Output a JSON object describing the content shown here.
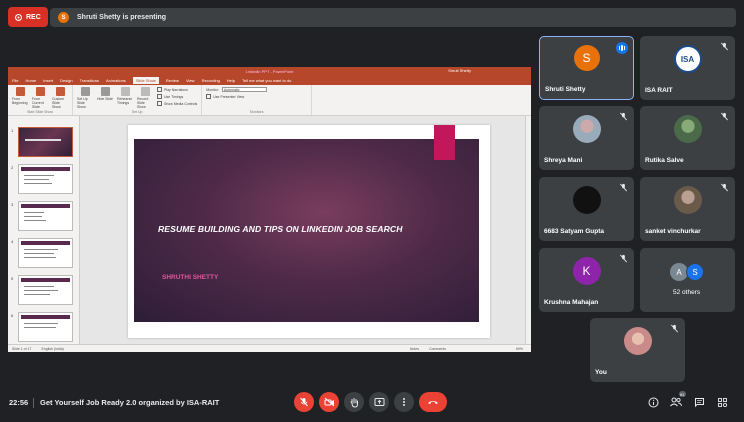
{
  "recording": {
    "label": "REC"
  },
  "presenter_bar": {
    "initial": "S",
    "text": "Shruti Shetty is presenting"
  },
  "powerpoint": {
    "window_title": "Linkedin PPT - PowerPoint",
    "user": "Shruti Shetty",
    "menu": [
      "File",
      "Home",
      "Insert",
      "Design",
      "Transitions",
      "Animations",
      "Slide Show",
      "Review",
      "View",
      "Recording",
      "Help",
      "Tell me what you want to do"
    ],
    "active_tab": "Slide Show",
    "ribbon": {
      "from_beginning": "From Beginning",
      "from_current": "From Current Slide",
      "custom_show": "Custom Slide Show",
      "start_group": "Start Slide Show",
      "setup_show": "Set Up Slide Show",
      "hide_slide": "Hide Slide",
      "rehearse": "Rehearse Timings",
      "record": "Record Slide Show",
      "setup_group": "Set Up",
      "play_narrations": "Play Narrations",
      "use_timings": "Use Timings",
      "show_media": "Show Media Controls",
      "monitor_label": "Monitor:",
      "monitor_value": "Automatic",
      "presenter_view": "Use Presenter View",
      "monitors_group": "Monitors"
    },
    "slide": {
      "title": "RESUME BUILDING AND TIPS ON LINKEDIN JOB SEARCH",
      "subtitle": "SHRUTHI SHETTY"
    },
    "thumb_numbers": [
      "1",
      "2",
      "3",
      "4",
      "5",
      "6"
    ],
    "status": {
      "slide": "Slide 1 of 17",
      "language": "English (India)",
      "notes": "Notes",
      "comments": "Comments",
      "zoom": "69%"
    }
  },
  "participants": [
    {
      "name": "Shruti Shetty",
      "initial": "S",
      "color": "#e8710a"
    },
    {
      "name": "ISA RAIT",
      "initial": "ISA",
      "color": "#ffffff"
    },
    {
      "name": "Shreya Mani",
      "initial": "",
      "color": "#9ab"
    },
    {
      "name": "Rutika Salve",
      "initial": "",
      "color": "#5a7a5a"
    },
    {
      "name": "6683 Satyam Gupta",
      "initial": "",
      "color": "#111111"
    },
    {
      "name": "sanket vinchurkar",
      "initial": "",
      "color": "#8a7a6a"
    },
    {
      "name": "Krushna Mahajan",
      "initial": "K",
      "color": "#8e24aa"
    },
    {
      "name": "52 others",
      "initial": "AS",
      "color": "#5f6368"
    },
    {
      "name": "You",
      "initial": "",
      "color": "#c98a8a"
    }
  ],
  "others_avatars": [
    "A",
    "S"
  ],
  "meeting": {
    "time": "22:56",
    "title": "Get Yourself Job Ready 2.0 organized by ISA-RAIT",
    "people_count": "61"
  }
}
